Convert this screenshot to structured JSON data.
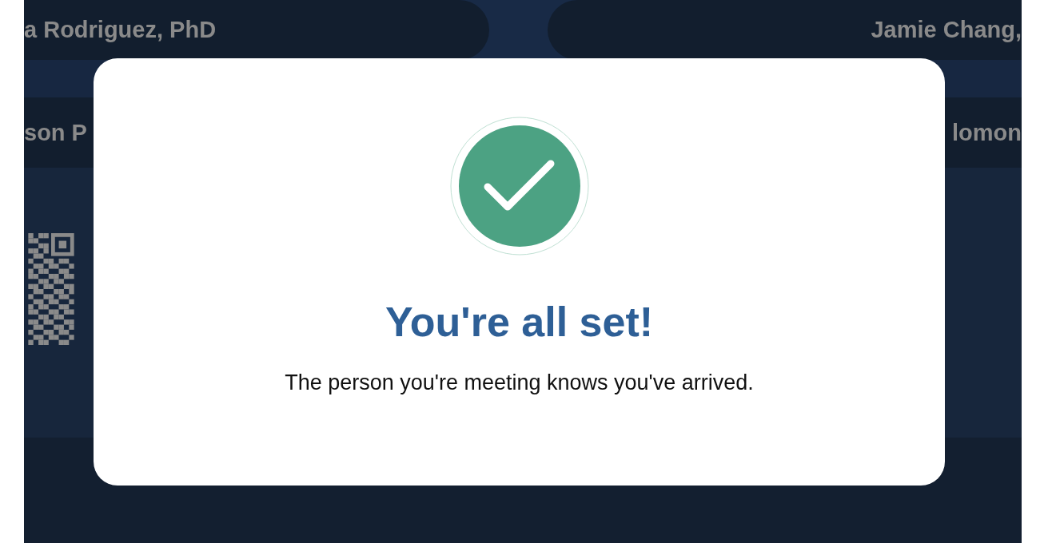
{
  "background": {
    "top_cards": [
      {
        "name": "a Rodriguez, PhD"
      },
      {
        "name": "Jamie Chang,"
      }
    ],
    "second_cards": [
      {
        "name": "son P"
      },
      {
        "name": "lomon"
      }
    ],
    "kiosk_code": {
      "kind": "qr"
    }
  },
  "dialog": {
    "kind": "success",
    "title": "You're all set!",
    "message": "The person you're meeting knows you've arrived."
  }
}
